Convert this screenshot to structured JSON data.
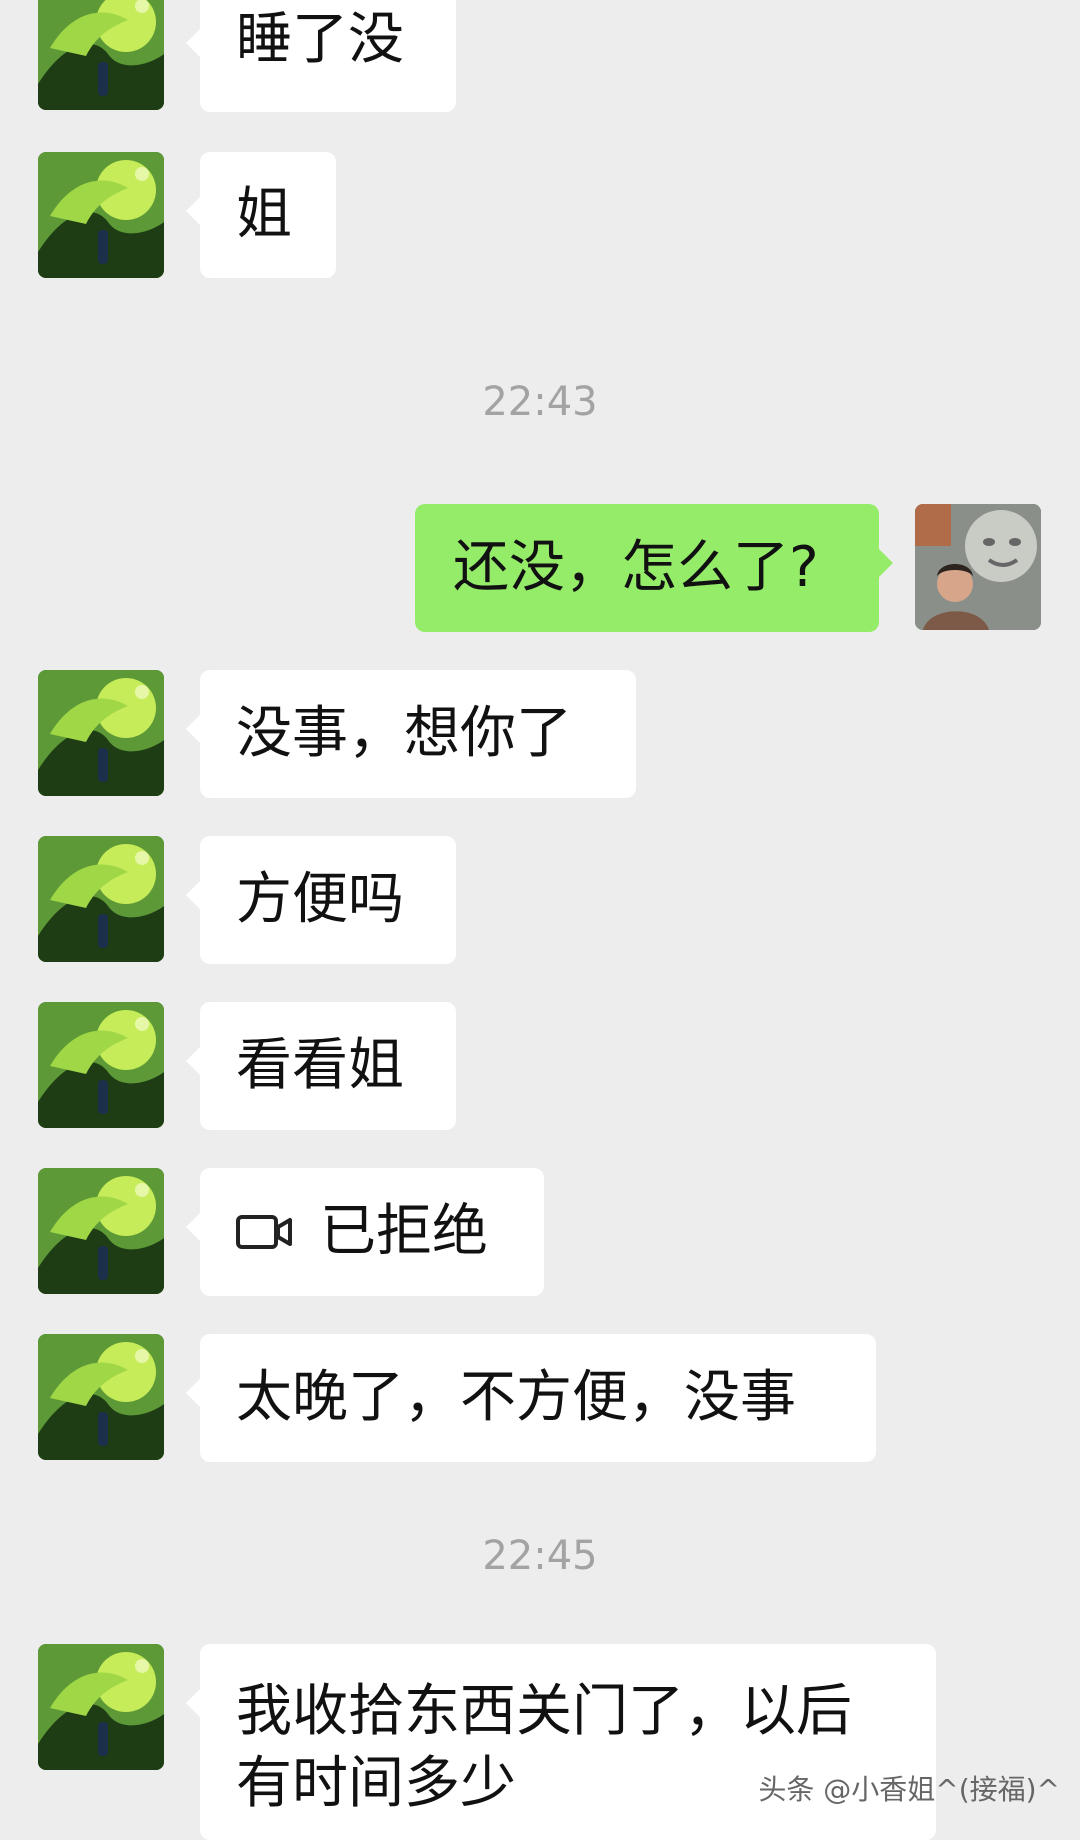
{
  "messages": [
    {
      "text": "睡了没"
    },
    {
      "text": "姐"
    },
    {
      "time": "22:43"
    },
    {
      "text": "还没，怎么了?"
    },
    {
      "text": "没事，想你了"
    },
    {
      "text": "方便吗"
    },
    {
      "text": "看看姐"
    },
    {
      "text": "已拒绝",
      "icon": "video-camera-icon"
    },
    {
      "text": "太晚了，不方便，没事"
    },
    {
      "time": "22:45"
    },
    {
      "line1": "我收拾东西关门了，以后",
      "line2": "有时间多少"
    }
  ],
  "watermark": "头条 @小香姐^(接福)^",
  "colors": {
    "background": "#ededed",
    "incoming_bubble": "#ffffff",
    "outgoing_bubble": "#95ec69",
    "timestamp": "#a3a3a3"
  }
}
